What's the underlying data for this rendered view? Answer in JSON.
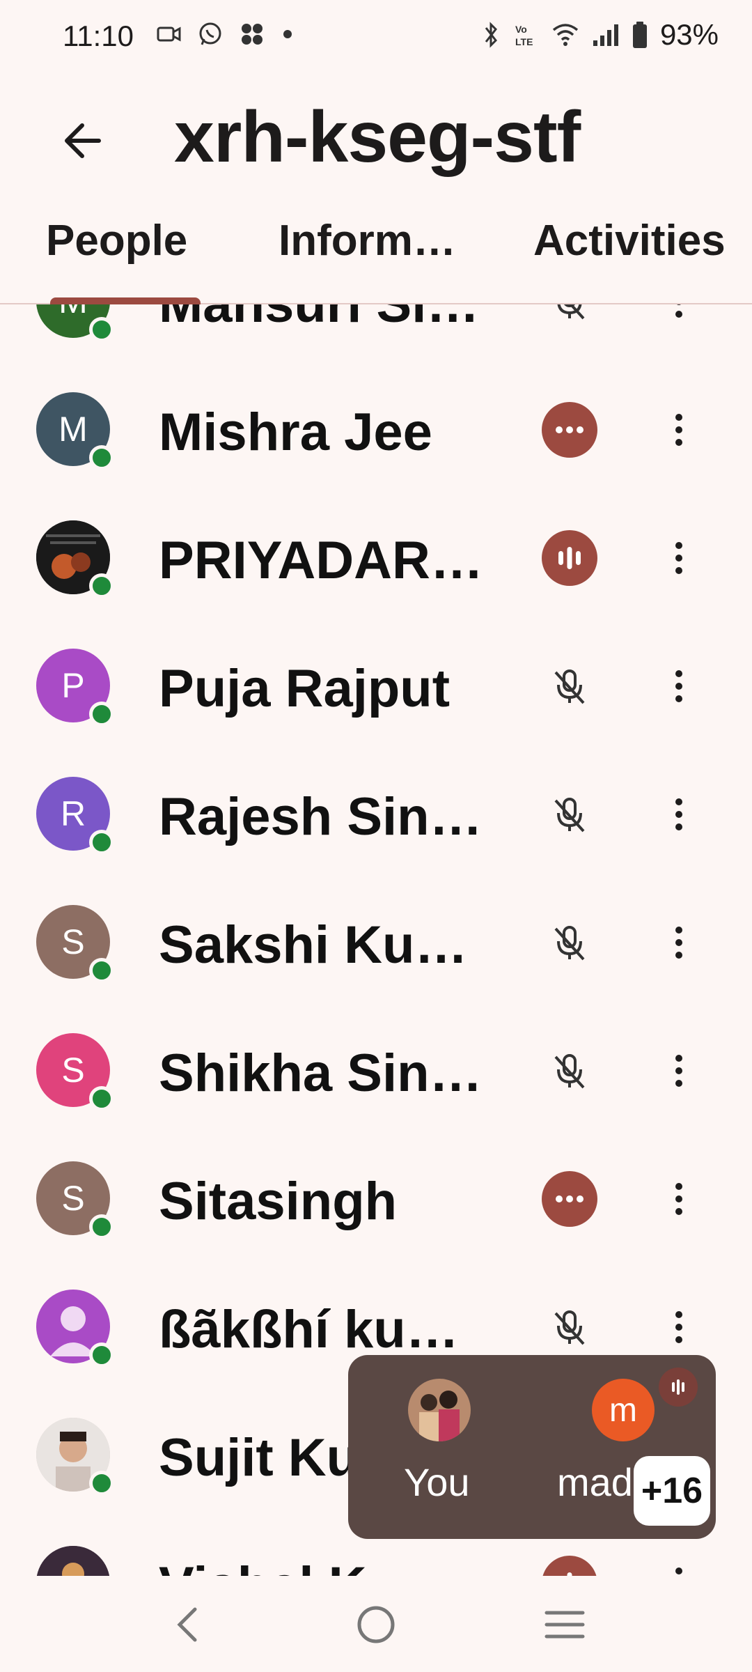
{
  "status_bar": {
    "time": "11:10",
    "battery": "93%",
    "network_label": "LTE",
    "icons_left": [
      "video-icon",
      "whatsapp-icon",
      "app-grid-icon",
      "dot-icon"
    ],
    "icons_right": [
      "bluetooth-icon",
      "volte-icon",
      "wifi-icon",
      "signal-icon",
      "battery-icon"
    ]
  },
  "header": {
    "back_icon": "arrow-back-icon",
    "title": "xrh-kseg-stf"
  },
  "tabs": [
    {
      "label": "People",
      "selected": true
    },
    {
      "label": "Inform…",
      "selected": false
    },
    {
      "label": "Activities",
      "selected": false
    }
  ],
  "colors": {
    "accent": "#9c4a40",
    "online": "#1f8a3a",
    "background": "#fdf6f4",
    "pip_bg": "#5a4844"
  },
  "participants": [
    {
      "name": "Mansuri Si…",
      "initial": "M",
      "avatar_color": "#2e6b2a",
      "status": "muted"
    },
    {
      "name": "Mishra Jee",
      "initial": "M",
      "avatar_color": "#3f5563",
      "status": "connecting"
    },
    {
      "name": "PRIYADAR…",
      "initial": "",
      "avatar_color": "#222222",
      "status": "speaking"
    },
    {
      "name": "Puja Rajput",
      "initial": "P",
      "avatar_color": "#a94bc6",
      "status": "muted"
    },
    {
      "name": "Rajesh Sin…",
      "initial": "R",
      "avatar_color": "#7b57c8",
      "status": "muted"
    },
    {
      "name": "Sakshi Ku…",
      "initial": "S",
      "avatar_color": "#8d6e63",
      "status": "muted"
    },
    {
      "name": "Shikha Sin…",
      "initial": "S",
      "avatar_color": "#e0437c",
      "status": "muted"
    },
    {
      "name": "Sitasingh",
      "initial": "S",
      "avatar_color": "#8d6e63",
      "status": "connecting"
    },
    {
      "name": "ßãkßhí ku…",
      "initial": "",
      "avatar_color": "#a94bc6",
      "status": "muted"
    },
    {
      "name": "Sujit Ku",
      "initial": "",
      "avatar_color": "#cfc7c2",
      "status": "muted"
    },
    {
      "name": "Vishal K…",
      "initial": "",
      "avatar_color": "#3a2a3a",
      "status": "speaking"
    }
  ],
  "self_view": {
    "you_label": "You",
    "other_initial": "m",
    "other_label": "madh",
    "more_count": "+16"
  },
  "nav": {
    "back": "nav-back-icon",
    "home": "nav-home-icon",
    "recents": "nav-recents-icon"
  }
}
